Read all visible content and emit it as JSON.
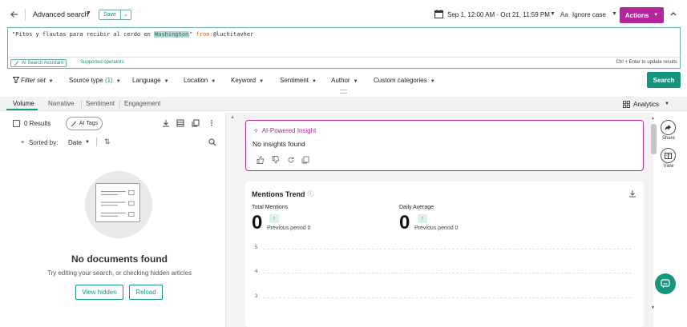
{
  "header": {
    "title": "Advanced search",
    "save_label": "Save",
    "date_range": "Sep 1, 12:00 AM - Oct 21, 11:59 PM",
    "case_icon": "Aa",
    "case_mode": "Ignore case",
    "actions_label": "Actions"
  },
  "query": {
    "phrase_open": "\"Pitos y flautas para recibir al cerdo en ",
    "phrase_highlight": "Washington",
    "phrase_close": "\" ",
    "operator": "from:",
    "operator_value": "@luchitavher",
    "ai_assistant_label": "AI Search Assistant",
    "supported_operators_label": "Supported operators",
    "update_hint": "Ctrl + Enter to update results"
  },
  "filters": {
    "filter_set": "Filter set",
    "source_type": "Source type",
    "source_count": "(1)",
    "language": "Language",
    "location": "Location",
    "keyword": "Keyword",
    "sentiment": "Sentiment",
    "author": "Author",
    "custom_categories": "Custom categories",
    "search_label": "Search"
  },
  "tabs": {
    "items": [
      "Volume",
      "Narrative",
      "Sentiment",
      "Engagement"
    ],
    "analytics_label": "Analytics"
  },
  "results": {
    "count_label": "0 Results",
    "ai_tags_label": "AI Tags",
    "sorted_by_label": "Sorted by:",
    "sort_field": "Date",
    "empty_title": "No documents found",
    "empty_hint": "Try editing your search, or checking hidden articles",
    "view_hidden_label": "View hidden",
    "reload_label": "Reload"
  },
  "insight": {
    "title": "AI-Powered Insight",
    "text": "No insights found"
  },
  "trend": {
    "title": "Mentions Trend",
    "total_label": "Total Mentions",
    "total_value": "0",
    "daily_label": "Daily Average",
    "daily_value": "0",
    "prev_label": "Previous period",
    "prev_total": "0",
    "prev_daily": "0",
    "y_ticks": [
      "5",
      "4",
      "3"
    ]
  },
  "rail": {
    "share_label": "Share",
    "view_label": "View"
  },
  "colors": {
    "accent_teal": "#17967f",
    "actions_magenta": "#b5259c"
  }
}
